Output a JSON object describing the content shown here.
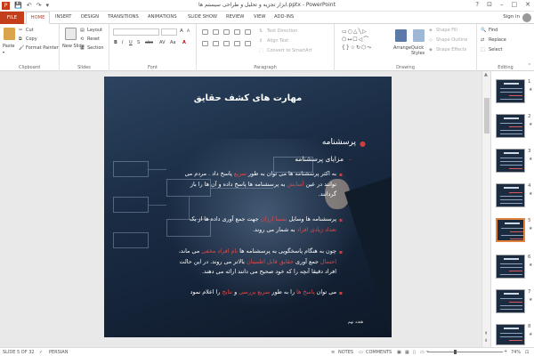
{
  "window": {
    "title": "ابزار تجزیه و تحلیل و طراحی سیستم ها.pptx - PowerPoint",
    "help_label": "?",
    "minimize_label": "–",
    "maximize_label": "□",
    "close_label": "✕"
  },
  "tabs": [
    {
      "label": "FILE"
    },
    {
      "label": "HOME"
    },
    {
      "label": "INSERT"
    },
    {
      "label": "DESIGN"
    },
    {
      "label": "TRANSITIONS"
    },
    {
      "label": "ANIMATIONS"
    },
    {
      "label": "SLIDE SHOW"
    },
    {
      "label": "REVIEW"
    },
    {
      "label": "VIEW"
    },
    {
      "label": "ADD-INS"
    }
  ],
  "sign_in": "Sign in",
  "ribbon": {
    "clipboard": {
      "label": "Clipboard",
      "paste": "Paste",
      "cut": "Cut",
      "copy": "Copy",
      "format_painter": "Format Painter"
    },
    "slides": {
      "label": "Slides",
      "new_slide": "New Slide",
      "layout": "Layout",
      "reset": "Reset",
      "section": "Section"
    },
    "font": {
      "label": "Font"
    },
    "paragraph": {
      "label": "Paragraph",
      "text_direction": "Text Direction",
      "align_text": "Align Text",
      "convert_smartart": "Convert to SmartArt"
    },
    "drawing": {
      "label": "Drawing",
      "arrange": "Arrange",
      "quick_styles": "Quick Styles",
      "shape_fill": "Shape Fill",
      "shape_outline": "Shape Outline",
      "shape_effects": "Shape Effects"
    },
    "editing": {
      "label": "Editing",
      "find": "Find",
      "replace": "Replace",
      "select": "Select"
    }
  },
  "slide": {
    "title": "مهارت های کشف حقایق",
    "level1": "پرسشنامه",
    "level2": "مزایای پرسشنامه",
    "b1_line1_a": "به اکثر پرسشنامه ها می توان به طور ",
    "b1_line1_hl": "سریع",
    "b1_line1_b": " پاسخ داد . مردم می",
    "b1_line2_a": "توانند در عین ",
    "b1_line2_hl": "آسایش",
    "b1_line2_b": " به پرسشنامه ها پاسخ داده و آن ها را باز",
    "b1_line3": "گردانند.",
    "b2_line1_a": "پرسشنامه ها وسایل ",
    "b2_line1_hl": "نسبتا ارزان",
    "b2_line1_b": " جهت جمع آوری داده ها از یک",
    "b2_line2_hl": "تعداد زیادی افراد",
    "b2_line2_b": " به شمار می روند.",
    "b3_line1_a": "چون به هنگام پاسخگویی به پرسشنامه ها ",
    "b3_line1_hl": "نام افراد مخفی",
    "b3_line1_b": " می ماند،",
    "b3_line2_hl1": "احتمال",
    "b3_line2_a": " جمع آوری ",
    "b3_line2_hl2": "حقایق قابل اطمینان",
    "b3_line2_b": " بالاتر می روند. در این حالت",
    "b3_line3": "افراد دقیقا آنچه را که خود صحیح می دانند ارائه می دهند.",
    "b4_a": "می توان ",
    "b4_hl1": "پاسخ ها",
    "b4_b": " را به طور ",
    "b4_hl2": "سریع بررسی",
    "b4_c": " و ",
    "b4_hl3": "نتایج",
    "b4_d": " را اعلام نمود",
    "footer": "هفته نهم"
  },
  "thumbnails": [
    {
      "number": "1"
    },
    {
      "number": "2"
    },
    {
      "number": "3"
    },
    {
      "number": "4"
    },
    {
      "number": "5"
    },
    {
      "number": "6"
    },
    {
      "number": "7"
    },
    {
      "number": "8"
    }
  ],
  "thumb_star": "★",
  "status": {
    "slide_of": "SLIDE 5 OF 32",
    "language": "PERSIAN",
    "notes": "NOTES",
    "comments": "COMMENTS",
    "zoom": "74%"
  },
  "colors": {
    "accent": "#c43e1c",
    "highlight": "#e04848",
    "selected_thumb": "#e3833c"
  }
}
